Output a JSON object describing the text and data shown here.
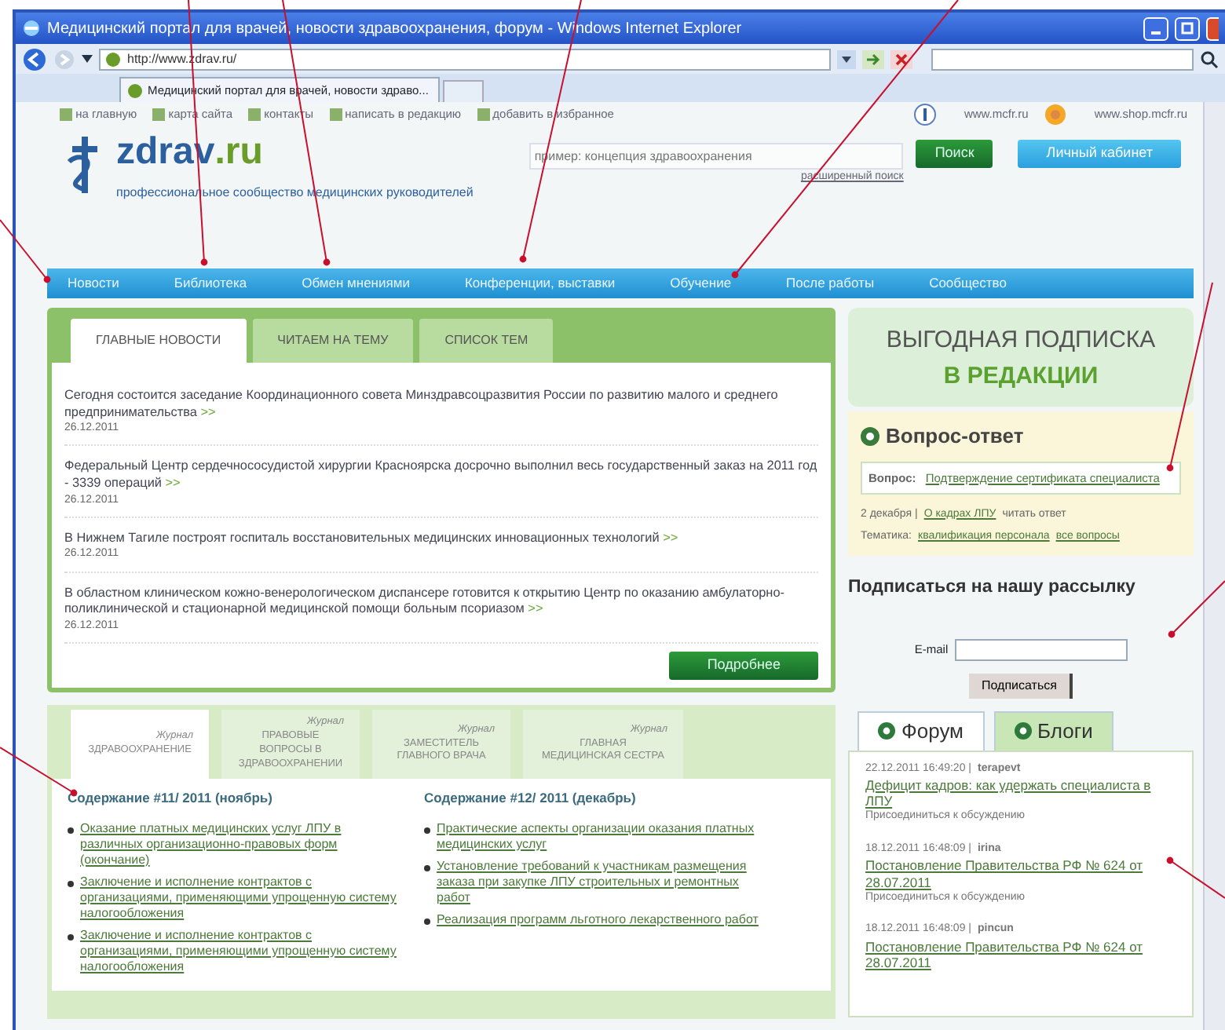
{
  "window": {
    "title": "Медицинский портал для врачей, новости здравоохранения, форум - Windows Internet Explorer"
  },
  "browser": {
    "address": "http://www.zdrav.ru/",
    "tab_title": "Медицинский портал для врачей, новости здраво..."
  },
  "top_links": [
    "на главную",
    "карта сайта",
    "контакты",
    "написать в редакцию",
    "добавить в избранное"
  ],
  "partner_links": [
    "www.mcfr.ru",
    "www.shop.mcfr.ru"
  ],
  "logo": {
    "name": "zdrav",
    "domain": ".ru",
    "tagline": "профессиональное сообщество медицинских руководителей"
  },
  "search": {
    "placeholder": "пример: концепция здравоохранения",
    "button": "Поиск",
    "advanced": "расширенный поиск"
  },
  "cabinet_button": "Личный кабинет",
  "nav": [
    "Новости",
    "Библиотека",
    "Обмен мнениями",
    "Конференции, выставки",
    "Обучение",
    "После работы",
    "Сообщество"
  ],
  "news": {
    "tabs": [
      {
        "label": "ГЛАВНЫЕ НОВОСТИ",
        "selected": true
      },
      {
        "label": "ЧИТАЕМ НА ТЕМУ",
        "selected": false
      },
      {
        "label": "СПИСОК ТЕМ",
        "selected": false
      }
    ],
    "items": [
      {
        "text": "Сегодня состоится заседание Координационного совета Минздравсоцразвития России по развитию малого и среднего предпринимательства",
        "more": ">>",
        "date": "26.12.2011"
      },
      {
        "text": "Федеральный Центр сердечнососудистой хирургии Красноярска досрочно выполнил весь государственный заказ на 2011 год - 3339 операций",
        "more": ">>",
        "date": "26.12.2011"
      },
      {
        "text": "В Нижнем Тагиле построят госпиталь восстановительных медицинских инновационных технологий",
        "more": ">>",
        "date": "26.12.2011"
      },
      {
        "text": "В областном клиническом кожно-венерологическом диспансере готовится к открытию Центр по оказанию амбулаторно-поликлинической и стационарной медицинской помощи больным псориазом",
        "more": ">>",
        "date": "26.12.2011"
      }
    ],
    "more_button": "Подробнее"
  },
  "journals": {
    "tabs": [
      {
        "kicker": "Журнал",
        "title": "ЗДРАВООХРАНЕНИЕ",
        "selected": true
      },
      {
        "kicker": "Журнал",
        "title": "ПРАВОВЫЕ ВОПРОСЫ В ЗДРАВООХРАНЕНИИ",
        "selected": false
      },
      {
        "kicker": "Журнал",
        "title": "ЗАМЕСТИТЕЛЬ ГЛАВНОГО ВРАЧА",
        "selected": false
      },
      {
        "kicker": "Журнал",
        "title": "ГЛАВНАЯ МЕДИЦИНСКАЯ СЕСТРА",
        "selected": false
      }
    ],
    "columns": [
      {
        "heading": "Содержание #11/ 2011 (ноябрь)",
        "items": [
          "Оказание платных медицинских услуг ЛПУ в различных организационно-правовых форм (окончание)",
          "Заключение и исполнение контрактов с организациями, применяющими упрощенную систему налогообложения",
          "Заключение и исполнение контрактов с организациями, применяющими упрощенную систему налогообложения"
        ]
      },
      {
        "heading": "Содержание #12/ 2011 (декабрь)",
        "items": [
          "Практические аспекты организации оказания платных медицинских услуг",
          "Установление требований к участникам размещения заказа при закупке ЛПУ строительных и ремонтных работ",
          "Реализация программ льготного лекарственного работ"
        ]
      }
    ]
  },
  "promo": {
    "line1": "ВЫГОДНАЯ ПОДПИСКА",
    "line2": "В РЕДАКЦИИ"
  },
  "qa": {
    "title": "Вопрос-ответ",
    "question_label": "Вопрос:",
    "question": "Подтверждение сертификата специалиста",
    "date": "2 декабря |",
    "answer_link": "О кадрах ЛПУ",
    "answer_tail": "читать ответ",
    "topic_label": "Тематика:",
    "topic": "квалификация персонала",
    "all_link": "все вопросы"
  },
  "subscribe": {
    "title": "Подписаться на нашу рассылку",
    "email_label": "E-mail",
    "button": "Подписаться"
  },
  "social": {
    "tabs": [
      {
        "label": "Форум",
        "selected": true
      },
      {
        "label": "Блоги",
        "selected": false
      }
    ],
    "posts": [
      {
        "datetime": "22.12.2011 16:49:20 |",
        "user": "terapevt",
        "title": "Дефицит кадров: как удержать специалиста в ЛПУ",
        "action": "Присоединиться к обсуждению"
      },
      {
        "datetime": "18.12.2011 16:48:09 |",
        "user": "irina",
        "title": "Постановление Правительства РФ № 624 от 28.07.2011",
        "action": "Присоединиться к обсуждению"
      },
      {
        "datetime": "18.12.2011 16:48:09 |",
        "user": "pincun",
        "title": "Постановление Правительства РФ № 624 от 28.07.2011"
      }
    ]
  }
}
